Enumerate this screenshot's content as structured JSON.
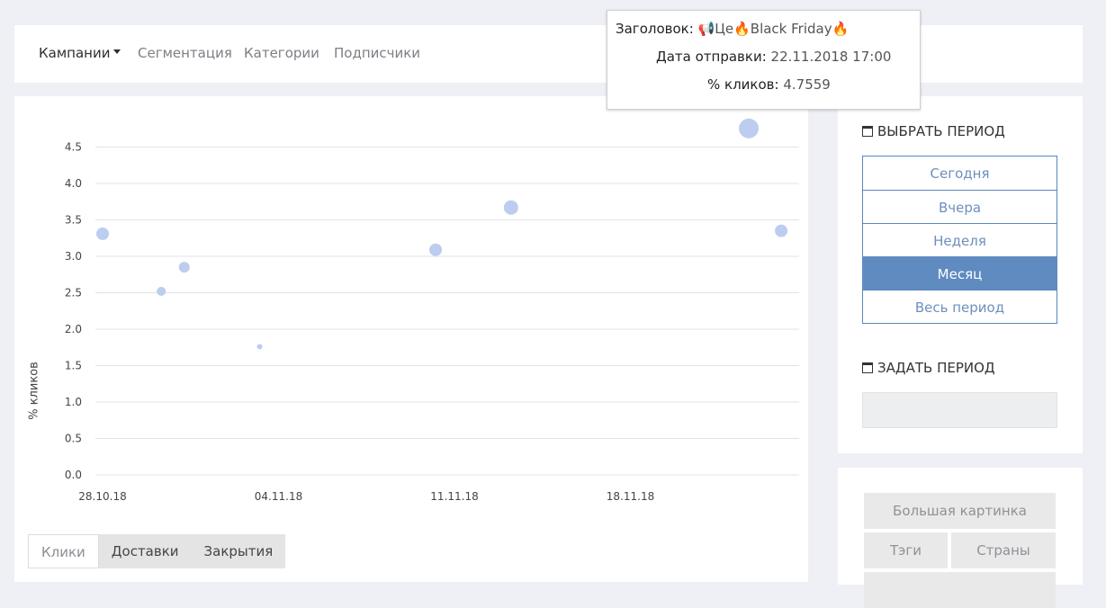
{
  "nav": {
    "items": [
      {
        "label": "Кампании",
        "active": true
      },
      {
        "label": "Сегментация"
      },
      {
        "label": "Категории"
      },
      {
        "label": "Подписчики"
      }
    ]
  },
  "chart_data": {
    "type": "scatter",
    "ylabel": "% кликов",
    "xlabel": "",
    "x_ticks": [
      "28.10.18",
      "04.11.18",
      "11.11.18",
      "18.11.18"
    ],
    "y_ticks": [
      0.0,
      0.5,
      1.0,
      1.5,
      2.0,
      2.5,
      3.0,
      3.5,
      4.0,
      4.5
    ],
    "ylim": [
      0,
      4.5
    ],
    "grid": true,
    "marker_color": "#bccdef",
    "points": [
      {
        "x": "28.10.18 00:00",
        "y": 3.31,
        "r": 7
      },
      {
        "x": "30.10.18 08:00",
        "y": 2.52,
        "r": 5
      },
      {
        "x": "31.10.18 06:00",
        "y": 2.85,
        "r": 6
      },
      {
        "x": "03.11.18 06:00",
        "y": 1.76,
        "r": 3
      },
      {
        "x": "10.11.18 06:00",
        "y": 3.09,
        "r": 7
      },
      {
        "x": "13.11.18 06:00",
        "y": 3.67,
        "r": 8
      },
      {
        "x": "22.11.18 17:00",
        "y": 4.7559,
        "r": 11
      },
      {
        "x": "24.11.18 00:00",
        "y": 3.35,
        "r": 7
      }
    ]
  },
  "tabs": [
    {
      "label": "Клики",
      "active": true
    },
    {
      "label": "Доставки"
    },
    {
      "label": "Закрытия"
    }
  ],
  "sidebar": {
    "choose_title": "ВЫБРАТЬ ПЕРИОД",
    "periods": [
      {
        "label": "Сегодня"
      },
      {
        "label": "Вчера"
      },
      {
        "label": "Неделя"
      },
      {
        "label": "Месяц",
        "active": true
      },
      {
        "label": "Весь период"
      }
    ],
    "custom_title": "ЗАДАТЬ ПЕРИОД",
    "date_value": ""
  },
  "buttons": {
    "big_picture": "Большая картинка",
    "tags": "Тэги",
    "countries": "Страны"
  },
  "tooltip": {
    "title_key": "Заголовок:",
    "title_val": "📢Це🔥Black Friday🔥",
    "date_key": "Дата отправки:",
    "date_val": "22.11.2018 17:00",
    "clicks_key": "% кликов:",
    "clicks_val": "4.7559"
  }
}
